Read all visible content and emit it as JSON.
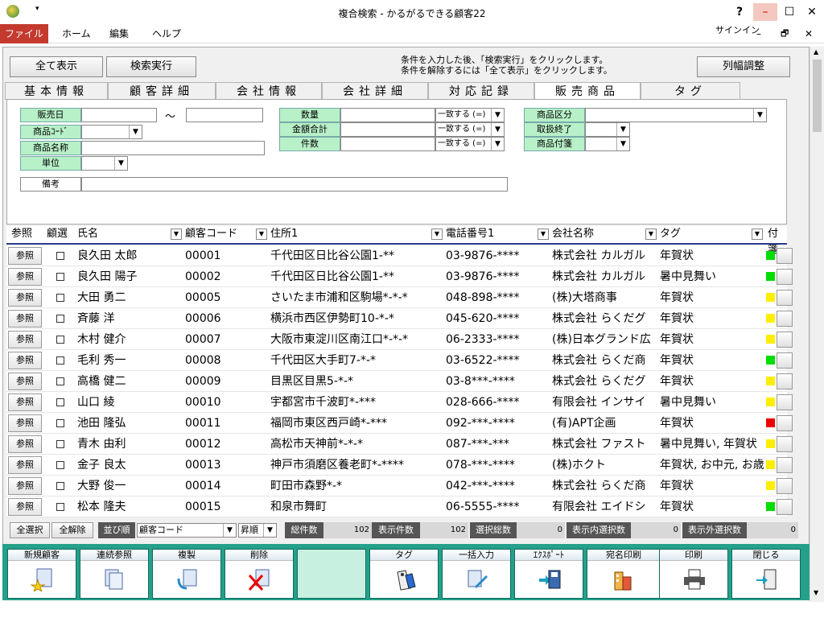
{
  "window": {
    "title": "複合検索 - かるがるできる顧客22",
    "help": "?",
    "minimize": "–",
    "maximize": "☐",
    "close": "✕"
  },
  "menu": {
    "file": "ファイル",
    "home": "ホーム",
    "edit": "編集",
    "help": "ヘルプ",
    "signin": "サインイン",
    "restore": "🗗",
    "min2": "–",
    "close2": "✕"
  },
  "top": {
    "show_all": "全て表示",
    "search": "検索実行",
    "note1": "条件を入力した後、「検索実行」をクリックします。",
    "note2": "条件を解除するには「全て表示」をクリックします。",
    "col_adjust": "列幅調整"
  },
  "tabs": [
    "基本情報",
    "顧客詳細",
    "会社情報",
    "会社詳細",
    "対応記録",
    "販売商品",
    "タグ"
  ],
  "cond": {
    "sale_date": "販売日",
    "tilde": "〜",
    "product_code": "商品ｺｰﾄﾞ",
    "product_name": "商品名称",
    "unit": "単位",
    "remarks": "備考",
    "quantity": "数量",
    "amount_total": "金額合計",
    "count": "件数",
    "match": "一致する (=)",
    "category": "商品区分",
    "discontinued": "取扱終了",
    "tag": "商品付箋"
  },
  "grid": {
    "headers": {
      "ref": "参照",
      "select": "顧選",
      "name": "氏名",
      "code": "顧客コード",
      "address": "住所1",
      "phone": "電話番号1",
      "company": "会社名称",
      "tag": "タグ",
      "sticky": "付箋"
    },
    "ref_label": "参照",
    "rows": [
      {
        "name": "良久田 太郎",
        "code": "00001",
        "address": "千代田区日比谷公園1-**",
        "phone": "03-9876-****",
        "company": "株式会社 カルガル",
        "tag": "年賀状",
        "color": "#00dd00"
      },
      {
        "name": "良久田 陽子",
        "code": "00002",
        "address": "千代田区日比谷公園1-**",
        "phone": "03-9876-****",
        "company": "株式会社 カルガル",
        "tag": "暑中見舞い",
        "color": "#00dd00"
      },
      {
        "name": "大田 勇二",
        "code": "00005",
        "address": "さいたま市浦和区駒場*-*-*",
        "phone": "048-898-****",
        "company": "(株)大塔商事",
        "tag": "年賀状",
        "color": "#ffee00"
      },
      {
        "name": "斉藤 洋",
        "code": "00006",
        "address": "横浜市西区伊勢町10-*-*",
        "phone": "045-620-****",
        "company": "株式会社 らくだグ",
        "tag": "年賀状",
        "color": "#ffee00"
      },
      {
        "name": "木村 健介",
        "code": "00007",
        "address": "大阪市東淀川区南江口*-*-*",
        "phone": "06-2333-****",
        "company": "(株)日本グランド広",
        "tag": "年賀状",
        "color": "#ffee00"
      },
      {
        "name": "毛利 秀一",
        "code": "00008",
        "address": "千代田区大手町7-*-*",
        "phone": "03-6522-****",
        "company": "株式会社 らくだ商",
        "tag": "年賀状",
        "color": "#00dd00"
      },
      {
        "name": "高橋 健二",
        "code": "00009",
        "address": "目黒区目黒5-*-*",
        "phone": "03-8***-****",
        "company": "株式会社 らくだグ",
        "tag": "年賀状",
        "color": "#ffee00"
      },
      {
        "name": "山口 綾",
        "code": "00010",
        "address": "宇都宮市千波町*-***",
        "phone": "028-666-****",
        "company": "有限会社 インサイ",
        "tag": "暑中見舞い",
        "color": "#ffee00"
      },
      {
        "name": "池田 隆弘",
        "code": "00011",
        "address": "福岡市東区西戸崎*-***",
        "phone": "092-***-****",
        "company": "(有)APT企画",
        "tag": "年賀状",
        "color": "#ee0000"
      },
      {
        "name": "青木 由利",
        "code": "00012",
        "address": "高松市天神前*-*-*",
        "phone": "087-***-***",
        "company": "株式会社 ファスト",
        "tag": "暑中見舞い, 年賀状",
        "color": "#ffee00"
      },
      {
        "name": "金子 良太",
        "code": "00013",
        "address": "神戸市須磨区養老町*-****",
        "phone": "078-***-****",
        "company": "(株)ホクト",
        "tag": "年賀状, お中元, お歳",
        "color": "#ffee00"
      },
      {
        "name": "大野 俊一",
        "code": "00014",
        "address": "町田市森野*-*",
        "phone": "042-***-****",
        "company": "株式会社 らくだ商",
        "tag": "年賀状",
        "color": "#ffee00"
      },
      {
        "name": "松本 隆夫",
        "code": "00015",
        "address": "和泉市舞町",
        "phone": "06-5555-****",
        "company": "有限会社 エイドシ",
        "tag": "年賀状",
        "color": "#00dd00"
      }
    ]
  },
  "status": {
    "select_all": "全選択",
    "deselect_all": "全解除",
    "sort": "並び順",
    "sort_field": "顧客コード",
    "order": "昇順",
    "total_label": "総件数",
    "total": "102",
    "shown_label": "表示件数",
    "shown": "102",
    "selected_label": "選択総数",
    "selected": "0",
    "in_sel_label": "表示内選択数",
    "in_sel": "0",
    "out_sel_label": "表示外選択数",
    "out_sel": "0"
  },
  "toolbar": [
    "新規顧客",
    "連続参照",
    "複製",
    "削除",
    "",
    "タグ",
    "一括入力",
    "ｴｸｽﾎﾟｰﾄ",
    "宛名印刷",
    "印刷",
    "閉じる"
  ]
}
